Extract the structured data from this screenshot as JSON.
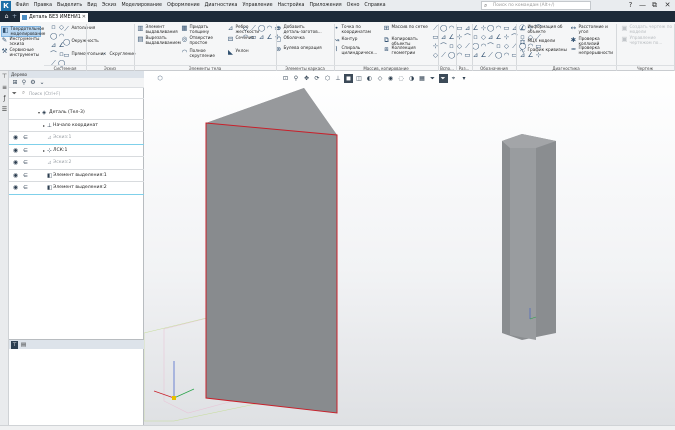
{
  "app": {
    "logo": "К"
  },
  "menu": [
    "Файл",
    "Правка",
    "Выделить",
    "Вид",
    "Эскиз",
    "Моделирование",
    "Оформление",
    "Диагностика",
    "Управление",
    "Настройка",
    "Приложения",
    "Окно",
    "Справка"
  ],
  "search": {
    "placeholder": "Поиск по командам (Alt+/)"
  },
  "window_controls": [
    "?",
    "—",
    "⧉",
    "✕"
  ],
  "tab": {
    "title": "Деталь БЕЗ ИМЕНИ1",
    "home_icon": "home-icon",
    "add_icon": "plus-icon"
  },
  "ribbon": {
    "buttons": [
      {
        "label": "Твердотельное моделирование",
        "icon": "solid-modeling-icon"
      },
      {
        "label": "Инструменты эскиза",
        "icon": "sketch-tools-icon"
      },
      {
        "label": "Сервисные инструменты",
        "icon": "service-tools-icon"
      },
      {
        "label": "Автолиния",
        "icon": "autoline-icon"
      },
      {
        "label": "Окружность",
        "icon": "circle-icon"
      },
      {
        "label": "Прямоугольник",
        "icon": "rectangle-icon"
      },
      {
        "label": "Скругление",
        "icon": "fillet-icon"
      },
      {
        "label": "Элемент выдавливания",
        "icon": "extrude-icon"
      },
      {
        "label": "Вырезать выдавливанием",
        "icon": "cut-extrude-icon"
      },
      {
        "label": "Придать толщину",
        "icon": "thicken-icon"
      },
      {
        "label": "Отверстие простое",
        "icon": "hole-icon"
      },
      {
        "label": "Полное скругление",
        "icon": "full-fillet-icon"
      },
      {
        "label": "Ребро жесткости",
        "icon": "rib-icon"
      },
      {
        "label": "Сечение",
        "icon": "section-icon"
      },
      {
        "label": "Уклон",
        "icon": "draft-icon"
      },
      {
        "label": "Добавить деталь-заготов...",
        "icon": "add-part-icon"
      },
      {
        "label": "Оболочка",
        "icon": "shell-icon"
      },
      {
        "label": "Булева операция",
        "icon": "boolean-icon"
      },
      {
        "label": "Точка по координатам",
        "icon": "point-icon"
      },
      {
        "label": "Контур",
        "icon": "contour-icon"
      },
      {
        "label": "Спираль цилиндрическ...",
        "icon": "helix-icon"
      },
      {
        "label": "Массив по сетке",
        "icon": "grid-array-icon"
      },
      {
        "label": "Копировать объекты",
        "icon": "copy-icon"
      },
      {
        "label": "Коллекция геометрии",
        "icon": "collection-icon"
      },
      {
        "label": "Информация об объекте",
        "icon": "info-icon"
      },
      {
        "label": "МЦХ модели",
        "icon": "mass-properties-icon"
      },
      {
        "label": "График кривизны",
        "icon": "curvature-icon"
      },
      {
        "label": "Расстояние и угол",
        "icon": "distance-icon"
      },
      {
        "label": "Проверка коллизий",
        "icon": "collision-icon"
      },
      {
        "label": "Проверка непрерывности",
        "icon": "continuity-icon"
      },
      {
        "label": "Создать чертеж по модели",
        "icon": "drawing-icon"
      },
      {
        "label": "Управление чертежом по...",
        "icon": "manage-drawing-icon"
      }
    ],
    "groups": [
      "Системная",
      "Эскиз",
      "Элементы тела",
      "Элементы каркаса",
      "Массив, копирование",
      "Вспо...",
      "Раз...",
      "Обозначения",
      "Диагностика",
      "Чертеж"
    ]
  },
  "left_strip": [
    "tree-icon",
    "layers-icon",
    "function-icon",
    "list-icon"
  ],
  "tree_panel": {
    "title": "Дерево",
    "filter_placeholder": "Поиск (Ctrl+F)",
    "rows": [
      {
        "label": "Деталь (Тел-3)",
        "icon": "part-icon"
      },
      {
        "label": "Начало координат",
        "icon": "origin-icon"
      },
      {
        "label": "Эскиз:1",
        "icon": "sketch-icon"
      },
      {
        "label": "ЛСК:1",
        "icon": "lcs-icon"
      },
      {
        "label": "Эскиз:2",
        "icon": "sketch-icon"
      },
      {
        "label": "Элемент выделения:1",
        "icon": "extrusion-icon"
      },
      {
        "label": "Элемент выделения:2",
        "icon": "extrusion-icon"
      }
    ]
  },
  "viewport": {
    "highlight_color": "#c8202a",
    "body_color": "#8a8d90"
  }
}
